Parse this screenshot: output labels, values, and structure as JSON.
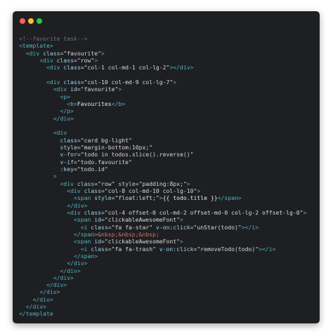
{
  "window": {
    "controls": [
      "close",
      "minimize",
      "maximize"
    ],
    "colors": {
      "close": "#ff5f56",
      "minimize": "#ffbd2e",
      "maximize": "#27c93f",
      "background": "#1e1f22"
    }
  },
  "code_lines": [
    [
      {
        "t": "<!--favorite task-->",
        "c": "comment"
      }
    ],
    [
      {
        "t": "<template>",
        "c": "tag"
      }
    ],
    [
      {
        "t": "  <div ",
        "c": "tag"
      },
      {
        "t": "class",
        "c": "attr"
      },
      {
        "t": "=\"favourite\"",
        "c": "str"
      },
      {
        "t": ">",
        "c": "tag"
      }
    ],
    [
      {
        "t": "      <div ",
        "c": "tag"
      },
      {
        "t": "class",
        "c": "attr"
      },
      {
        "t": "=\"row\"",
        "c": "str"
      },
      {
        "t": ">",
        "c": "tag"
      }
    ],
    [
      {
        "t": "        <div ",
        "c": "tag"
      },
      {
        "t": "class",
        "c": "attr"
      },
      {
        "t": "=\"col-1 col-md-1 col-lg-2\"",
        "c": "str"
      },
      {
        "t": "></div>",
        "c": "tag"
      }
    ],
    [
      {
        "t": "",
        "c": "text"
      }
    ],
    [
      {
        "t": "        <div ",
        "c": "tag"
      },
      {
        "t": "class",
        "c": "attr"
      },
      {
        "t": "=\"col-10 col-md-9 col-lg-7\"",
        "c": "str"
      },
      {
        "t": ">",
        "c": "tag"
      }
    ],
    [
      {
        "t": "          <div ",
        "c": "tag"
      },
      {
        "t": "id",
        "c": "attr"
      },
      {
        "t": "=\"favourite\"",
        "c": "str"
      },
      {
        "t": ">",
        "c": "tag"
      }
    ],
    [
      {
        "t": "            <p>",
        "c": "tag"
      }
    ],
    [
      {
        "t": "              <b>",
        "c": "tag"
      },
      {
        "t": "Favourites",
        "c": "text"
      },
      {
        "t": "</b>",
        "c": "tag"
      }
    ],
    [
      {
        "t": "            </p>",
        "c": "tag"
      }
    ],
    [
      {
        "t": "          </div>",
        "c": "tag"
      }
    ],
    [
      {
        "t": "",
        "c": "text"
      }
    ],
    [
      {
        "t": "          <div",
        "c": "tag"
      }
    ],
    [
      {
        "t": "            ",
        "c": "text"
      },
      {
        "t": "class",
        "c": "attr"
      },
      {
        "t": "=\"card bg-light\"",
        "c": "str"
      }
    ],
    [
      {
        "t": "            ",
        "c": "text"
      },
      {
        "t": "style",
        "c": "attr"
      },
      {
        "t": "=\"margin-bottom:10px;\"",
        "c": "str"
      }
    ],
    [
      {
        "t": "            ",
        "c": "text"
      },
      {
        "t": "v-for",
        "c": "attr"
      },
      {
        "t": "=\"todo in todos.slice().reverse()\"",
        "c": "str"
      }
    ],
    [
      {
        "t": "            ",
        "c": "text"
      },
      {
        "t": "v-if",
        "c": "attr"
      },
      {
        "t": "=\"todo.favourite\"",
        "c": "str"
      }
    ],
    [
      {
        "t": "            ",
        "c": "text"
      },
      {
        "t": ":key",
        "c": "attr"
      },
      {
        "t": "=\"todo.id\"",
        "c": "str"
      }
    ],
    [
      {
        "t": "          >",
        "c": "tag"
      }
    ],
    [
      {
        "t": "            <div ",
        "c": "tag"
      },
      {
        "t": "class",
        "c": "attr"
      },
      {
        "t": "=\"row\" ",
        "c": "str"
      },
      {
        "t": "style",
        "c": "attr"
      },
      {
        "t": "=\"padding:8px;\"",
        "c": "str"
      },
      {
        "t": ">",
        "c": "tag"
      }
    ],
    [
      {
        "t": "              <div ",
        "c": "tag"
      },
      {
        "t": "class",
        "c": "attr"
      },
      {
        "t": "=\"col-8 col-md-10 col-lg-10\"",
        "c": "str"
      },
      {
        "t": ">",
        "c": "tag"
      }
    ],
    [
      {
        "t": "                <span ",
        "c": "tag"
      },
      {
        "t": "style",
        "c": "attr"
      },
      {
        "t": "=\"float:left;\"",
        "c": "str"
      },
      {
        "t": ">",
        "c": "tag"
      },
      {
        "t": "{{ todo.title }}",
        "c": "text"
      },
      {
        "t": "</span>",
        "c": "tag"
      }
    ],
    [
      {
        "t": "              </div>",
        "c": "tag"
      }
    ],
    [
      {
        "t": "              <div ",
        "c": "tag"
      },
      {
        "t": "class",
        "c": "attr"
      },
      {
        "t": "=\"col-4 offset-0 col-md-2 offset-md-0 col-lg-2 offset-lg-0\"",
        "c": "str"
      },
      {
        "t": ">",
        "c": "tag"
      }
    ],
    [
      {
        "t": "                <span ",
        "c": "tag"
      },
      {
        "t": "id",
        "c": "attr"
      },
      {
        "t": "=\"clickableAwesomeFont\"",
        "c": "str"
      },
      {
        "t": ">",
        "c": "tag"
      }
    ],
    [
      {
        "t": "                  <i ",
        "c": "tag"
      },
      {
        "t": "class",
        "c": "attr"
      },
      {
        "t": "=\"fa fa-star\" ",
        "c": "str"
      },
      {
        "t": "v-on:click",
        "c": "attr"
      },
      {
        "t": "=\"unStar(todo)\"",
        "c": "str"
      },
      {
        "t": "></i>",
        "c": "tag"
      }
    ],
    [
      {
        "t": "                </span>",
        "c": "tag"
      },
      {
        "t": "&nbsp;&nbsp;&nbsp;",
        "c": "entity"
      }
    ],
    [
      {
        "t": "                <span ",
        "c": "tag"
      },
      {
        "t": "id",
        "c": "attr"
      },
      {
        "t": "=\"clickableAwesomeFont\"",
        "c": "str"
      },
      {
        "t": ">",
        "c": "tag"
      }
    ],
    [
      {
        "t": "                  <i ",
        "c": "tag"
      },
      {
        "t": "class",
        "c": "attr"
      },
      {
        "t": "=\"fa fa-trash\" ",
        "c": "str"
      },
      {
        "t": "v-on:click",
        "c": "attr"
      },
      {
        "t": "=\"removeTodo(todo)\"",
        "c": "str"
      },
      {
        "t": "></i>",
        "c": "tag"
      }
    ],
    [
      {
        "t": "                </span>",
        "c": "tag"
      }
    ],
    [
      {
        "t": "              </div>",
        "c": "tag"
      }
    ],
    [
      {
        "t": "            </div>",
        "c": "tag"
      }
    ],
    [
      {
        "t": "          </div>",
        "c": "tag"
      }
    ],
    [
      {
        "t": "        </div>",
        "c": "tag"
      }
    ],
    [
      {
        "t": "      </div>",
        "c": "tag"
      }
    ],
    [
      {
        "t": "    </div>",
        "c": "tag"
      }
    ],
    [
      {
        "t": "  </div>",
        "c": "tag"
      }
    ],
    [
      {
        "t": "</template",
        "c": "tag"
      }
    ]
  ]
}
